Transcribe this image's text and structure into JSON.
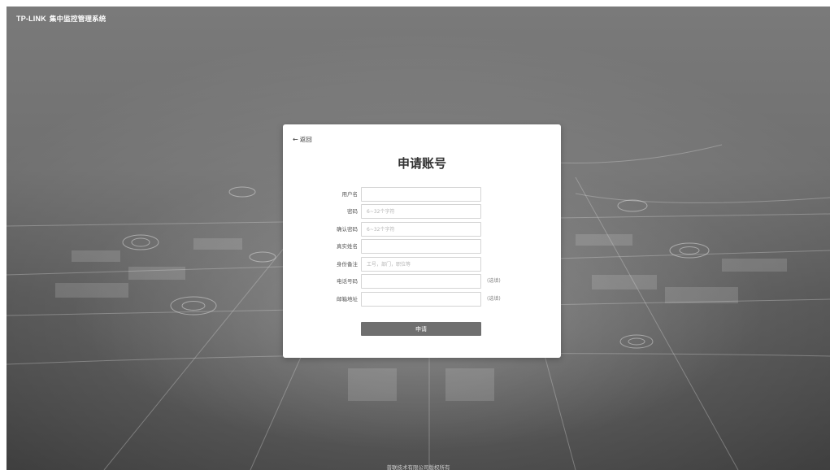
{
  "header": {
    "logo_text": "TP-LINK",
    "system_name": "集中监控管理系统"
  },
  "form": {
    "back_label": "返回",
    "title": "申请账号",
    "fields": [
      {
        "label": "用户名",
        "value": "",
        "placeholder": "",
        "note": ""
      },
      {
        "label": "密码",
        "value": "",
        "placeholder": "6~32个字符",
        "note": ""
      },
      {
        "label": "确认密码",
        "value": "",
        "placeholder": "6~32个字符",
        "note": ""
      },
      {
        "label": "真实姓名",
        "value": "",
        "placeholder": "",
        "note": ""
      },
      {
        "label": "身份备注",
        "value": "",
        "placeholder": "工号，部门，职位等",
        "note": ""
      },
      {
        "label": "电话号码",
        "value": "",
        "placeholder": "",
        "note": "(选填)"
      },
      {
        "label": "邮箱地址",
        "value": "",
        "placeholder": "",
        "note": "(选填)"
      }
    ],
    "submit_label": "申请"
  },
  "footer": {
    "copyright": "普联技术有限公司版权所有"
  },
  "colors": {
    "background": "#707070",
    "card": "#ffffff",
    "submit_button": "#6f6f6f"
  }
}
